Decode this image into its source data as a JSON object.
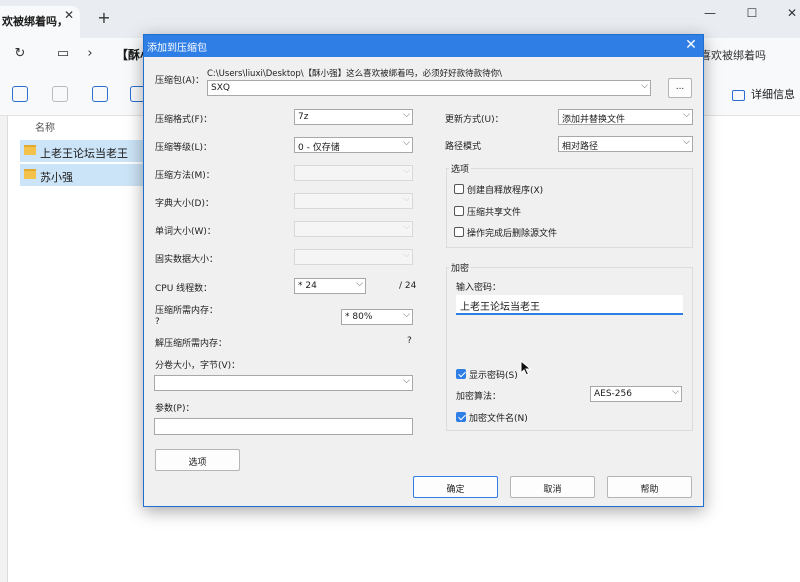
{
  "explorer": {
    "tab_title": "欢被绑着吗，",
    "address_crumb": "【酥小",
    "address_right": "喜欢被绑着吗",
    "details_label": "详细信息",
    "column_name": "名称",
    "files": [
      "上老王论坛当老王",
      "苏小强"
    ]
  },
  "dialog": {
    "title": "添加到压缩包",
    "archive_label": "压缩包(A)：",
    "archive_path": "C:\\Users\\liuxi\\Desktop\\【酥小强】这么喜欢被绑着吗，必须好好款待款待你\\",
    "archive_name": "SXQ",
    "browse_label": "...",
    "left": {
      "format_label": "压缩格式(F)：",
      "format_value": "7z",
      "level_label": "压缩等级(L)：",
      "level_value": "0 - 仅存储",
      "method_label": "压缩方法(M)：",
      "dict_label": "字典大小(D)：",
      "word_label": "单词大小(W)：",
      "solid_label": "固实数据大小：",
      "cpu_label": "CPU 线程数：",
      "cpu_value": "* 24",
      "cpu_total": "/ 24",
      "mem_label": "压缩所需内存：",
      "mem_q": "?",
      "mem_value": "* 80%",
      "decomp_label": "解压缩所需内存：",
      "decomp_q": "?",
      "volume_label": "分卷大小，字节(V)：",
      "params_label": "参数(P)：",
      "options_button": "选项"
    },
    "right": {
      "update_label": "更新方式(U)：",
      "update_value": "添加并替换文件",
      "path_label": "路径模式",
      "path_value": "相对路径",
      "options_group": "选项",
      "opt_sfx": "创建自释放程序(X)",
      "opt_shared": "压缩共享文件",
      "opt_delete": "操作完成后删除源文件",
      "encrypt_group": "加密",
      "enter_pwd_label": "输入密码：",
      "password": "上老王论坛当老王",
      "show_pwd": "显示密码(S)",
      "enc_method_label": "加密算法：",
      "enc_method_value": "AES-256",
      "enc_names": "加密文件名(N)"
    },
    "ok_button": "确定",
    "cancel_button": "取消",
    "help_button": "帮助"
  },
  "colors": {
    "accent": "#2f7ee6",
    "selection": "#cce4f7"
  }
}
